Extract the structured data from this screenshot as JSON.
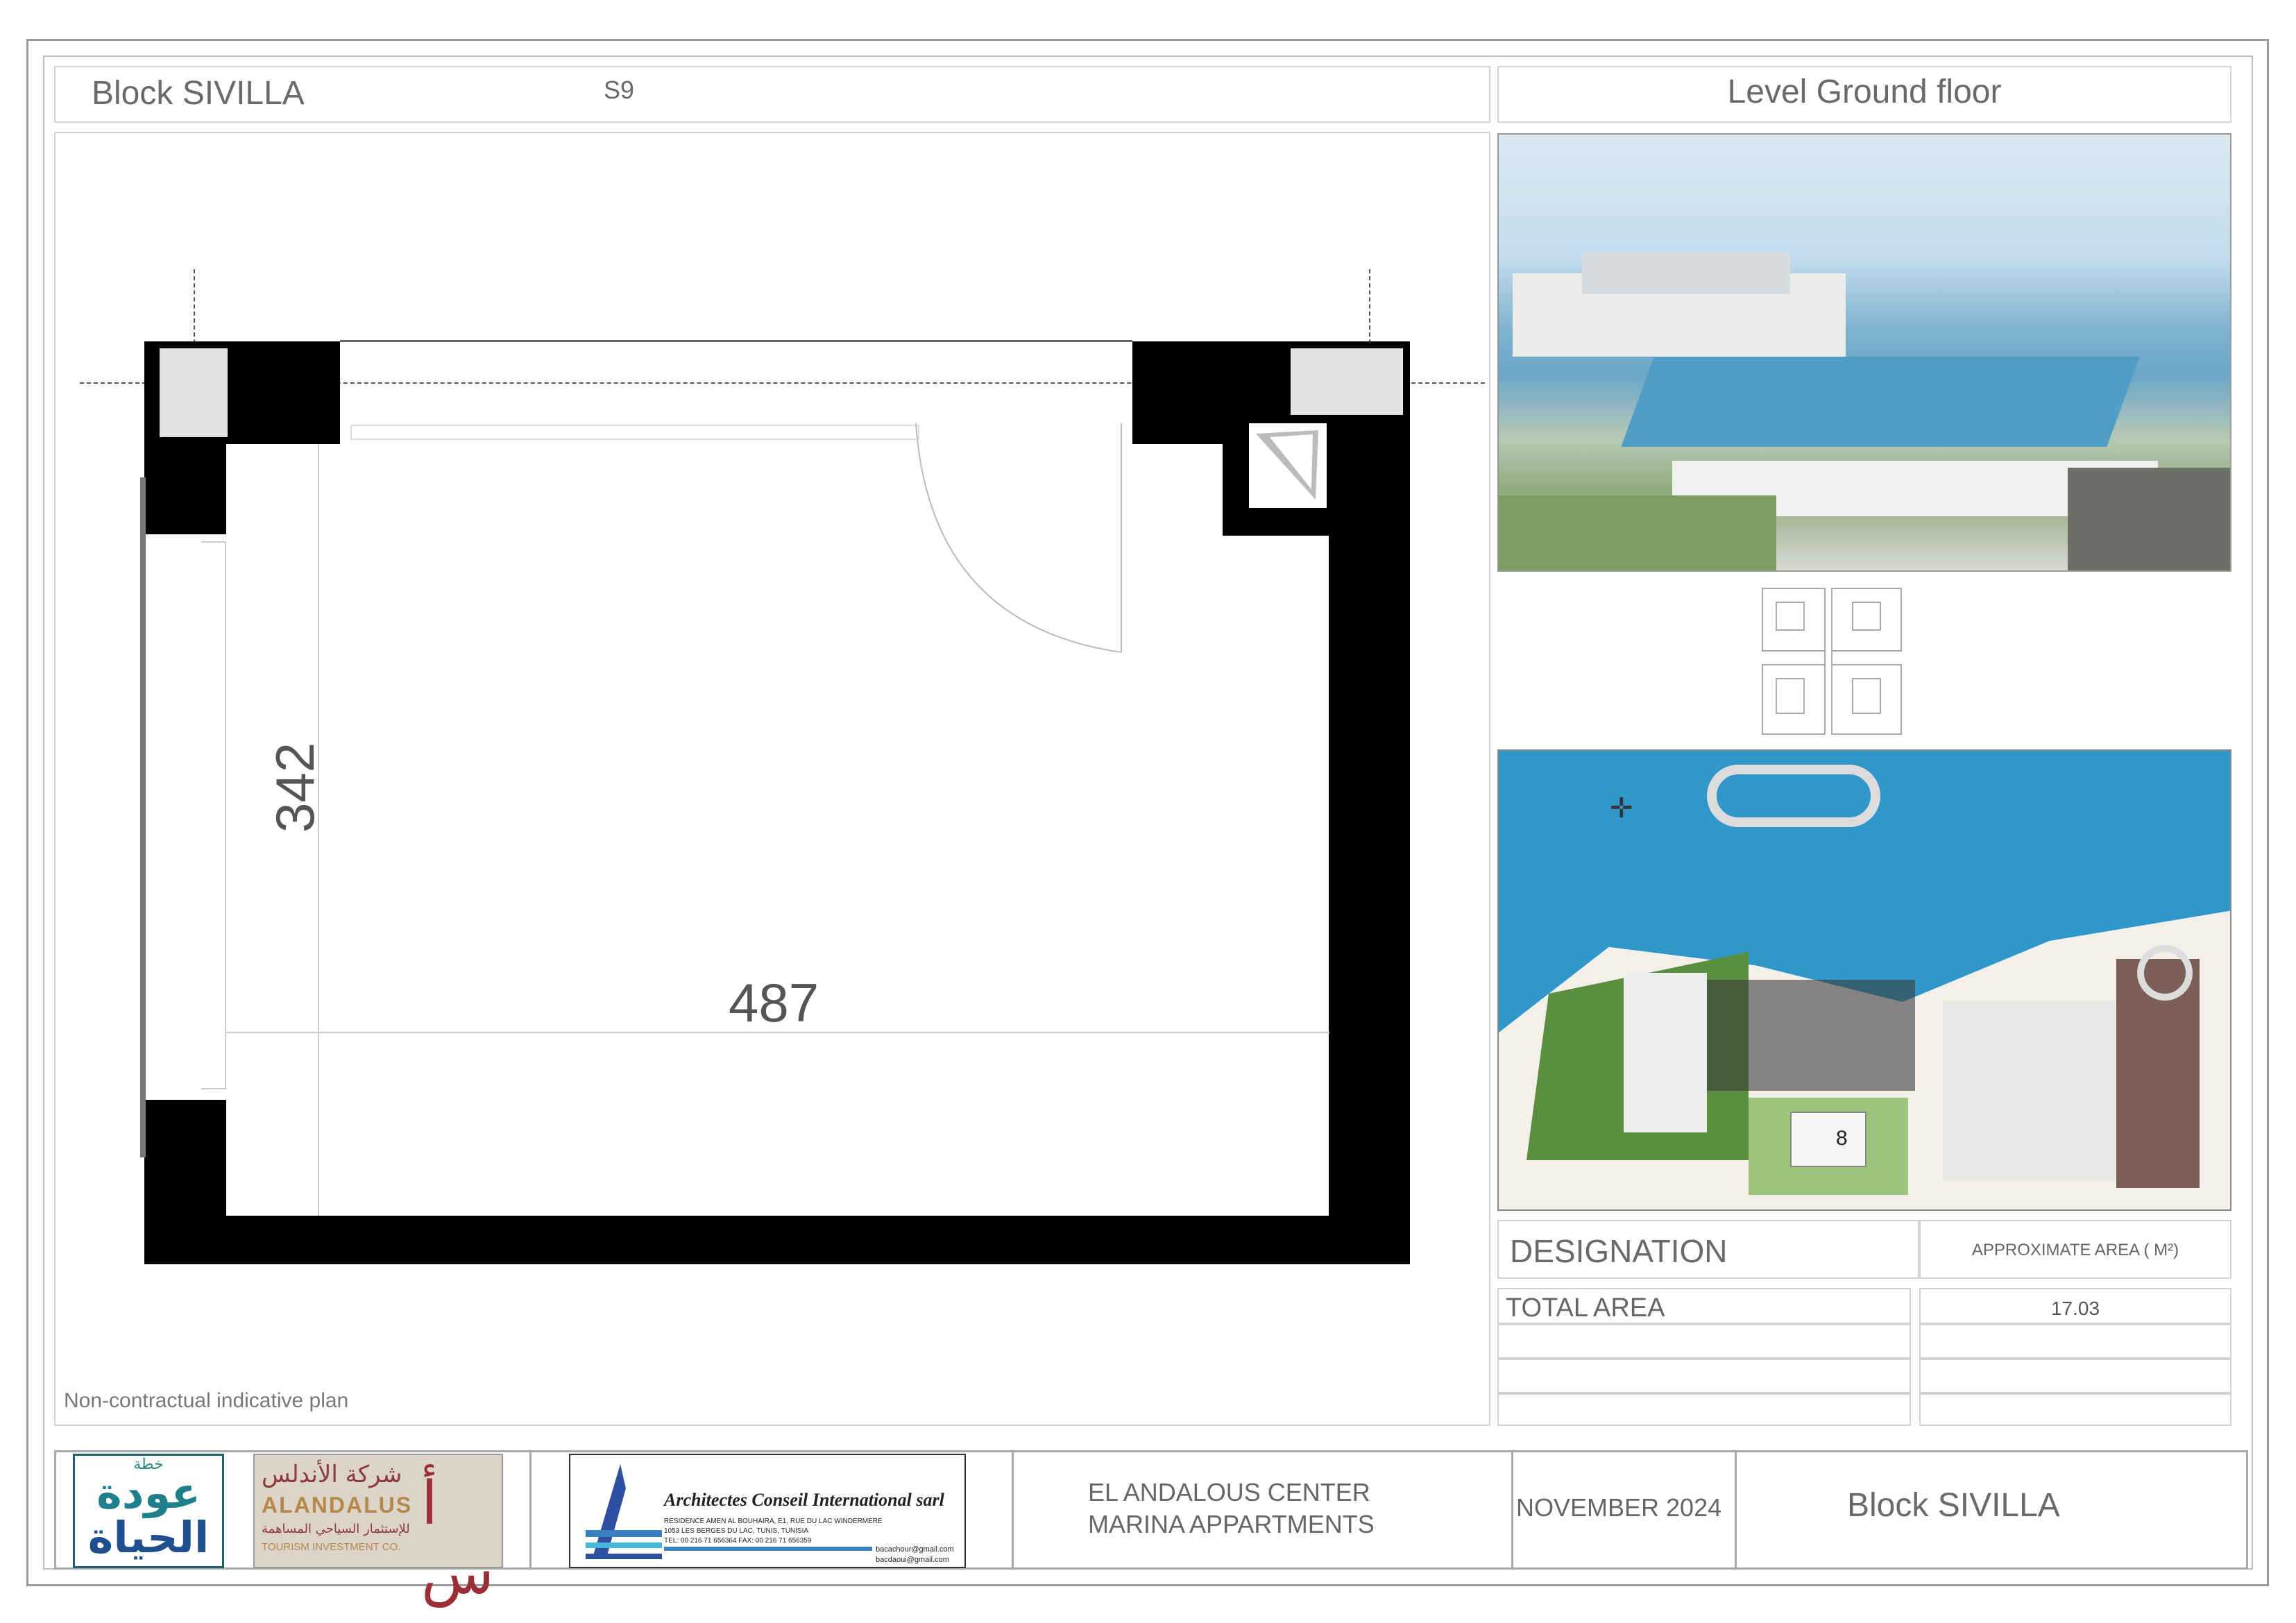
{
  "header": {
    "block_title": "Block SIVILLA",
    "unit_code": "S9",
    "level": "Level Ground floor"
  },
  "plan": {
    "dim_width": "487",
    "dim_height": "342",
    "note": "Non-contractual indicative plan"
  },
  "area_table": {
    "designation_label": "DESIGNATION",
    "area_label": "APPROXIMATE AREA  ( M²)",
    "rows": [
      {
        "label": "TOTAL AREA",
        "value": "17.03"
      }
    ]
  },
  "footer": {
    "logo1": {
      "top": "خطة",
      "line1": "عودة",
      "line2": "الحياة"
    },
    "logo2": {
      "arabic": "شركة الأندلس",
      "latin": "ALANDALUS",
      "arabic_sub": "للإستثمار السياحي المساهمة",
      "latin_sub": "TOURISM INVESTMENT CO.",
      "mark": "أ س"
    },
    "architect": {
      "name": "Architectes  Conseil  International sarl",
      "addr1": "RESIDENCE  AMEN AL BOUHAIRA, E1, RUE DU LAC WINDERMERE",
      "addr2": "1053 LES BERGES DU LAC, TUNIS, TUNISIA",
      "tel": "TEL: 00 216 71 656364   FAX: 00 216 71 656359",
      "email1": "bacachour@gmail.com",
      "email2": "bacdaoui@gmail.com"
    },
    "project_line1": "EL ANDALOUS CENTER",
    "project_line2": "MARINA APPARTMENTS",
    "date": "NOVEMBER 2024",
    "block": "Block  SIVILLA"
  },
  "masterplan": {
    "building_label": "8"
  }
}
